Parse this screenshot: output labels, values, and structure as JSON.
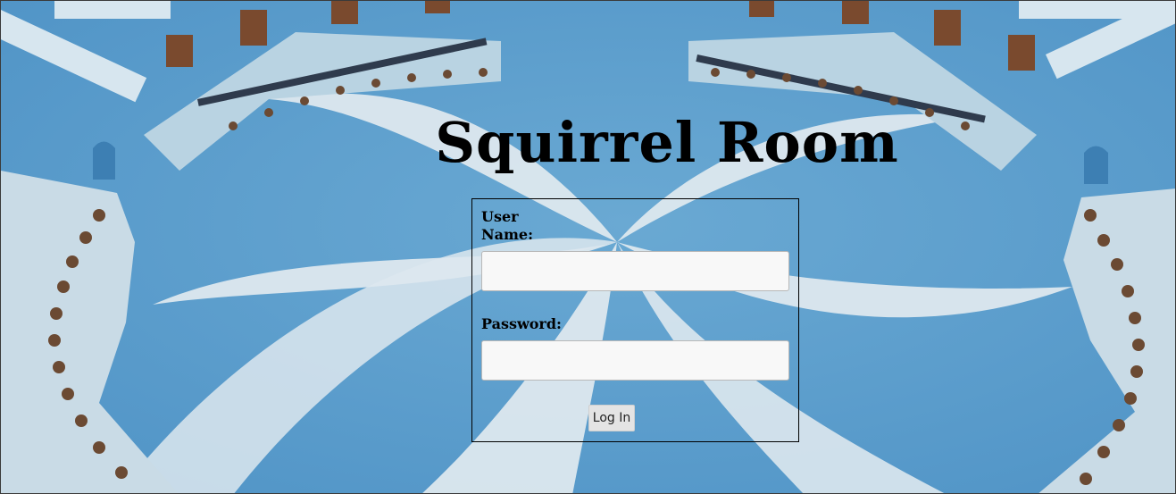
{
  "header": {
    "title": "Squirrel Room"
  },
  "login_form": {
    "username_label": "User Name:",
    "username_value": "",
    "password_label": "Password:",
    "password_value": "",
    "submit_label": "Log In"
  },
  "colors": {
    "background_blue": "#5fa0cd",
    "swirl_white": "#dfe9ee",
    "title_text": "#000000"
  }
}
